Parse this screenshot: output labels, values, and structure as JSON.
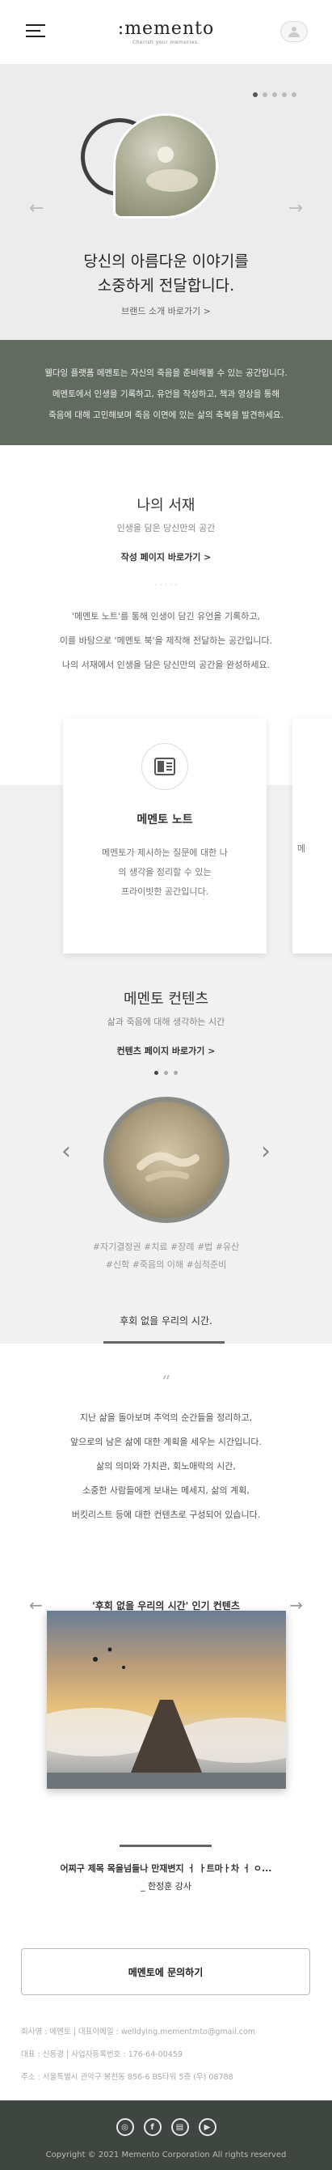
{
  "header": {
    "logo_main": ":memento",
    "logo_sub": "Cherish your memories."
  },
  "hero": {
    "title_line1": "당신의 아름다운 이야기를",
    "title_line2": "소중하게 전달합니다.",
    "link": "브랜드 소개 바로가기 >",
    "slide_count": 5,
    "active_slide": 1
  },
  "intro": {
    "lines": [
      "웰다잉 플랫폼 메멘토는 자신의 죽음을 준비해볼 수 있는 공간입니다.",
      "메멘토에서 인생을 기록하고, 유언을 작성하고, 책과 영상을 통해",
      "죽음에 대해 고민해보며 죽음 이면에 있는 삶의 축복을 발견하세요."
    ]
  },
  "library": {
    "title": "나의 서재",
    "subtitle": "인생을 담은 당신만의 공간",
    "link": "작성 페이지 바로가기 >",
    "separator": "· · · · ·",
    "body": [
      "'메멘토 노트'를 통해 인생이 담긴 유언을 기록하고,",
      "이를 바탕으로 '메멘토 북'을 제작해 전달하는 공간입니다.",
      "나의 서재에서 인생을 담은 당신만의 공간을 완성하세요."
    ]
  },
  "card": {
    "title": "메멘토 노트",
    "text": [
      "메멘토가 제시하는 질문에 대한 나",
      "의 생각을 정리할 수 있는",
      "프라이빗한 공간입니다."
    ],
    "next_text_fragment": "메"
  },
  "contents": {
    "title": "메멘토 컨텐츠",
    "subtitle": "삶과 죽음에 대해 생각하는 시간",
    "link": "컨텐츠 페이지 바로가기 >",
    "tags_line1": "#자기결정권 #치료 #장례 #법 #유산",
    "tags_line2": "#신학 #죽음의 이해 #심적준비",
    "slide_count": 3,
    "active_slide": 1
  },
  "tab": {
    "label": "후회 없을 우리의 시간."
  },
  "quote": {
    "mark": "“",
    "lines": [
      "지난 삶을 돌아보며 추억의 순간들을 정리하고,",
      "앞으로의 남은 삶에 대한 계획을 세우는 시간입니다.",
      "삶의 의미와 가치관, 회노애락의 시간,",
      "소중한 사람들에게 보내는 메세지, 삶의 계획,",
      "버킷리스트 등에 대한 컨텐츠로 구성되어 있습니다."
    ]
  },
  "popular": {
    "title": "'후회 없을 우리의 시간' 인기 컨텐츠",
    "caption_line1": "어찌구 제목 목을넘들나 만재변지 ㅓ ㅏ트마ㅏ차 ㅓ ㅇ...",
    "caption_line2": "_ 한정훈 강사"
  },
  "inquiry": {
    "label": "메멘토에 문의하기"
  },
  "company_info": {
    "line1": "회사명 : 메멘토  |  대표이메일 : welldying.mementmto@gmail.com",
    "line2": "대표 : 신동경  |  사업자등록번호 : 176-64-00459",
    "line3": "주소 : 서울특별시 관악구 봉천동 856-6 BS타워 5층 (우) 08788"
  },
  "footer": {
    "social": [
      {
        "icon": "instagram-icon",
        "glyph": "◎"
      },
      {
        "icon": "facebook-icon",
        "glyph": "f"
      },
      {
        "icon": "blog-icon",
        "glyph": "▤"
      },
      {
        "icon": "youtube-icon",
        "glyph": "▶"
      }
    ],
    "copyright": "Copyright © 2021 Memento Corporation All rights reserved"
  }
}
